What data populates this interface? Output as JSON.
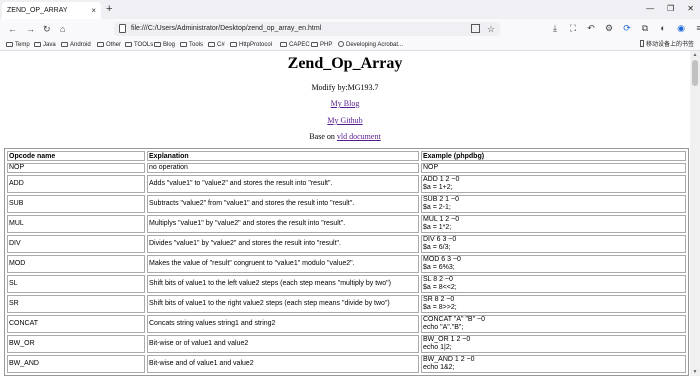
{
  "browser": {
    "tab_title": "ZEND_OP_ARRAY",
    "tab_close": "×",
    "new_tab": "+",
    "url": "file:///C:/Users/Administrator/Desktop/zend_op_array_en.html",
    "window_controls": [
      "—",
      "❐",
      "✕"
    ],
    "nav": {
      "back": "←",
      "forward": "→",
      "reload": "↻",
      "home": "⌂"
    },
    "bookmarks": [
      "Temp",
      "Java",
      "Android",
      "Other",
      "TOOLs",
      "Blog",
      "Tools",
      "C#",
      "HttpProtocol",
      "CAPEC",
      "PHP",
      "Developing Acrobat..."
    ],
    "mobile_bookmarks": "移动设备上的书签"
  },
  "page": {
    "title": "Zend_Op_Array",
    "modify_by": "Modify by:MG193.7",
    "blog_link": "My Blog",
    "github_link": "My Github",
    "base_on_prefix": "Base on ",
    "base_on_link": "vld document"
  },
  "table": {
    "headers": [
      "Opcode name",
      "Explanation",
      "Example (phpdbg)"
    ],
    "rows": [
      {
        "name": "NOP",
        "explanation": "no operation",
        "example": [
          "NOP"
        ]
      },
      {
        "name": "ADD",
        "explanation": "Adds \"value1\" to \"value2\" and stores the result into \"result\".",
        "example": [
          "ADD 1 2 ~0",
          "$a = 1+2;"
        ]
      },
      {
        "name": "SUB",
        "explanation": "Subtracts \"value2\" from \"value1\" and stores the result into \"result\".",
        "example": [
          "SUB 2 1 ~0",
          "$a = 2-1;"
        ]
      },
      {
        "name": "MUL",
        "explanation": "Multiplys \"value1\" by \"value2\" and stores the result into \"result\".",
        "example": [
          "MUL 1 2 ~0",
          "$a = 1*2;"
        ]
      },
      {
        "name": "DIV",
        "explanation": "Divides \"value1\" by \"value2\" and stores the result into \"result\".",
        "example": [
          "DIV 6 3 ~0",
          "$a = 6/3;"
        ]
      },
      {
        "name": "MOD",
        "explanation": "Makes the value of \"result\" congruent to \"value1\" modulo \"value2\".",
        "example": [
          "MOD 6 3 ~0",
          "$a = 6%3;"
        ]
      },
      {
        "name": "SL",
        "explanation": "Shift bits of value1 to the left value2 steps (each step means \"multiply by two\")",
        "example": [
          "SL 8 2 ~0",
          "$a = 8<<2;"
        ]
      },
      {
        "name": "SR",
        "explanation": "Shift bits of value1 to the right value2 steps (each step means \"divide by two\")",
        "example": [
          "SR 8 2 ~0",
          "$a = 8>>2;"
        ]
      },
      {
        "name": "CONCAT",
        "explanation": "Concats string values string1 and string2",
        "example": [
          "CONCAT \"A\" \"B\" ~0",
          "echo \"A\".\"B\";"
        ]
      },
      {
        "name": "BW_OR",
        "explanation": "Bit-wise or of value1 and value2",
        "example": [
          "BW_OR 1 2 ~0",
          "echo 1|2;"
        ]
      },
      {
        "name": "BW_AND",
        "explanation": "Bit-wise and of value1 and value2",
        "example": [
          "BW_AND 1 2 ~0",
          "echo 1&2;"
        ]
      }
    ]
  }
}
